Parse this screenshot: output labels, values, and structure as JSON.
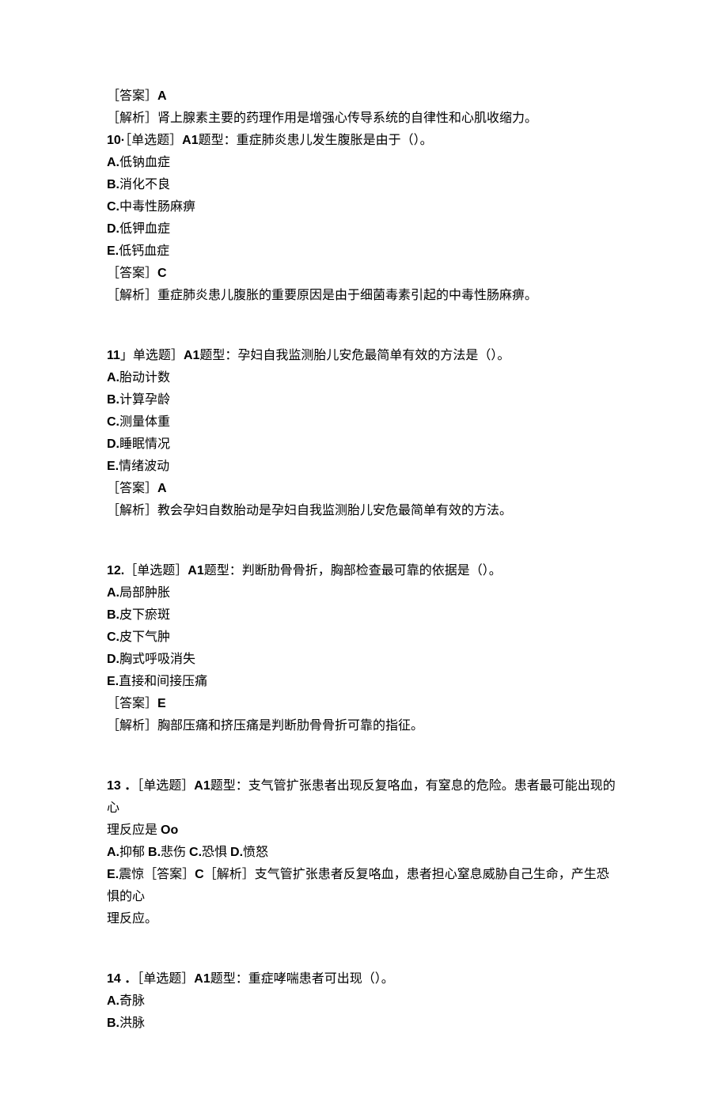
{
  "q_prev": {
    "answer_label": "［答案］",
    "answer_value": "A",
    "explain_label": "［解析］",
    "explain_text": "肾上腺素主要的药理作用是增强心传导系统的自律性和心肌收缩力。"
  },
  "q10": {
    "num": "10·",
    "type_label": "［单选题］",
    "a1": "A1",
    "stem_suffix": "题型：重症肺炎患儿发生腹胀是由于（）。",
    "opt_a_key": "A.",
    "opt_a_val": "低钠血症",
    "opt_b_key": "B.",
    "opt_b_val": "消化不良",
    "opt_c_key": "C.",
    "opt_c_val": "中毒性肠麻痹",
    "opt_d_key": "D.",
    "opt_d_val": "低钾血症",
    "opt_e_key": "E.",
    "opt_e_val": "低钙血症",
    "answer_label": "［答案］",
    "answer_value": "C",
    "explain_label": "［解析］",
    "explain_text": "重症肺炎患儿腹胀的重要原因是由于细菌毒素引起的中毒性肠麻痹。"
  },
  "q11": {
    "num": "11",
    "type_label": "」单选题］",
    "a1": "A1",
    "stem_suffix": "题型：孕妇自我监测胎儿安危最简单有效的方法是（）。",
    "opt_a_key": "A.",
    "opt_a_val": "胎动计数",
    "opt_b_key": "B.",
    "opt_b_val": "计算孕龄",
    "opt_c_key": "C.",
    "opt_c_val": "测量体重",
    "opt_d_key": "D.",
    "opt_d_val": "睡眠情况",
    "opt_e_key": "E.",
    "opt_e_val": "情绪波动",
    "answer_label": "［答案］",
    "answer_value": "A",
    "explain_label": "［解析］",
    "explain_text": "教会孕妇自数胎动是孕妇自我监测胎儿安危最简单有效的方法。"
  },
  "q12": {
    "num": "12.",
    "type_label": "［单选题］",
    "a1": "A1",
    "stem_suffix": "题型：判断肋骨骨折，胸部检查最可靠的依据是（）。",
    "opt_a_key": "A.",
    "opt_a_val": "局部肿胀",
    "opt_b_key": "B.",
    "opt_b_val": "皮下瘀斑",
    "opt_c_key": "C.",
    "opt_c_val": "皮下气肿",
    "opt_d_key": "D.",
    "opt_d_val": "胸式呼吸消失",
    "opt_e_key": "E.",
    "opt_e_val": "直接和间接压痛",
    "answer_label": "［答案］",
    "answer_value": "E",
    "explain_label": "［解析］",
    "explain_text": "胸部压痛和挤压痛是判断肋骨骨折可靠的指征。"
  },
  "q13": {
    "num": "13 ．",
    "type_label": "［单选题］",
    "a1": "A1",
    "stem_line1": "题型：支气管扩张患者出现反复咯血，有窒息的危险。患者最可能出现的心",
    "stem_line2_pre": "理反应是 ",
    "stem_line2_strong": "Oo",
    "opt_a_key": "A.",
    "opt_a_val": "抑郁 ",
    "opt_b_key": "B.",
    "opt_b_val": "悲伤 ",
    "opt_c_key": "C.",
    "opt_c_val": "恐惧 ",
    "opt_d_key": "D.",
    "opt_d_val": "愤怒",
    "opt_e_key": "E.",
    "opt_e_val": "震惊",
    "answer_label": "［答案］",
    "answer_value": "C",
    "explain_label": "［解析］",
    "explain_line1": "支气管扩张患者反复咯血，患者担心窒息威胁自己生命，产生恐惧的心",
    "explain_line2": "理反应。"
  },
  "q14": {
    "num": "14 ．",
    "type_label": "［单选题］",
    "a1": "A1",
    "stem_suffix": "题型：重症哮喘患者可出现（）。",
    "opt_a_key": "A.",
    "opt_a_val": "奇脉",
    "opt_b_key": "B.",
    "opt_b_val": "洪脉"
  }
}
